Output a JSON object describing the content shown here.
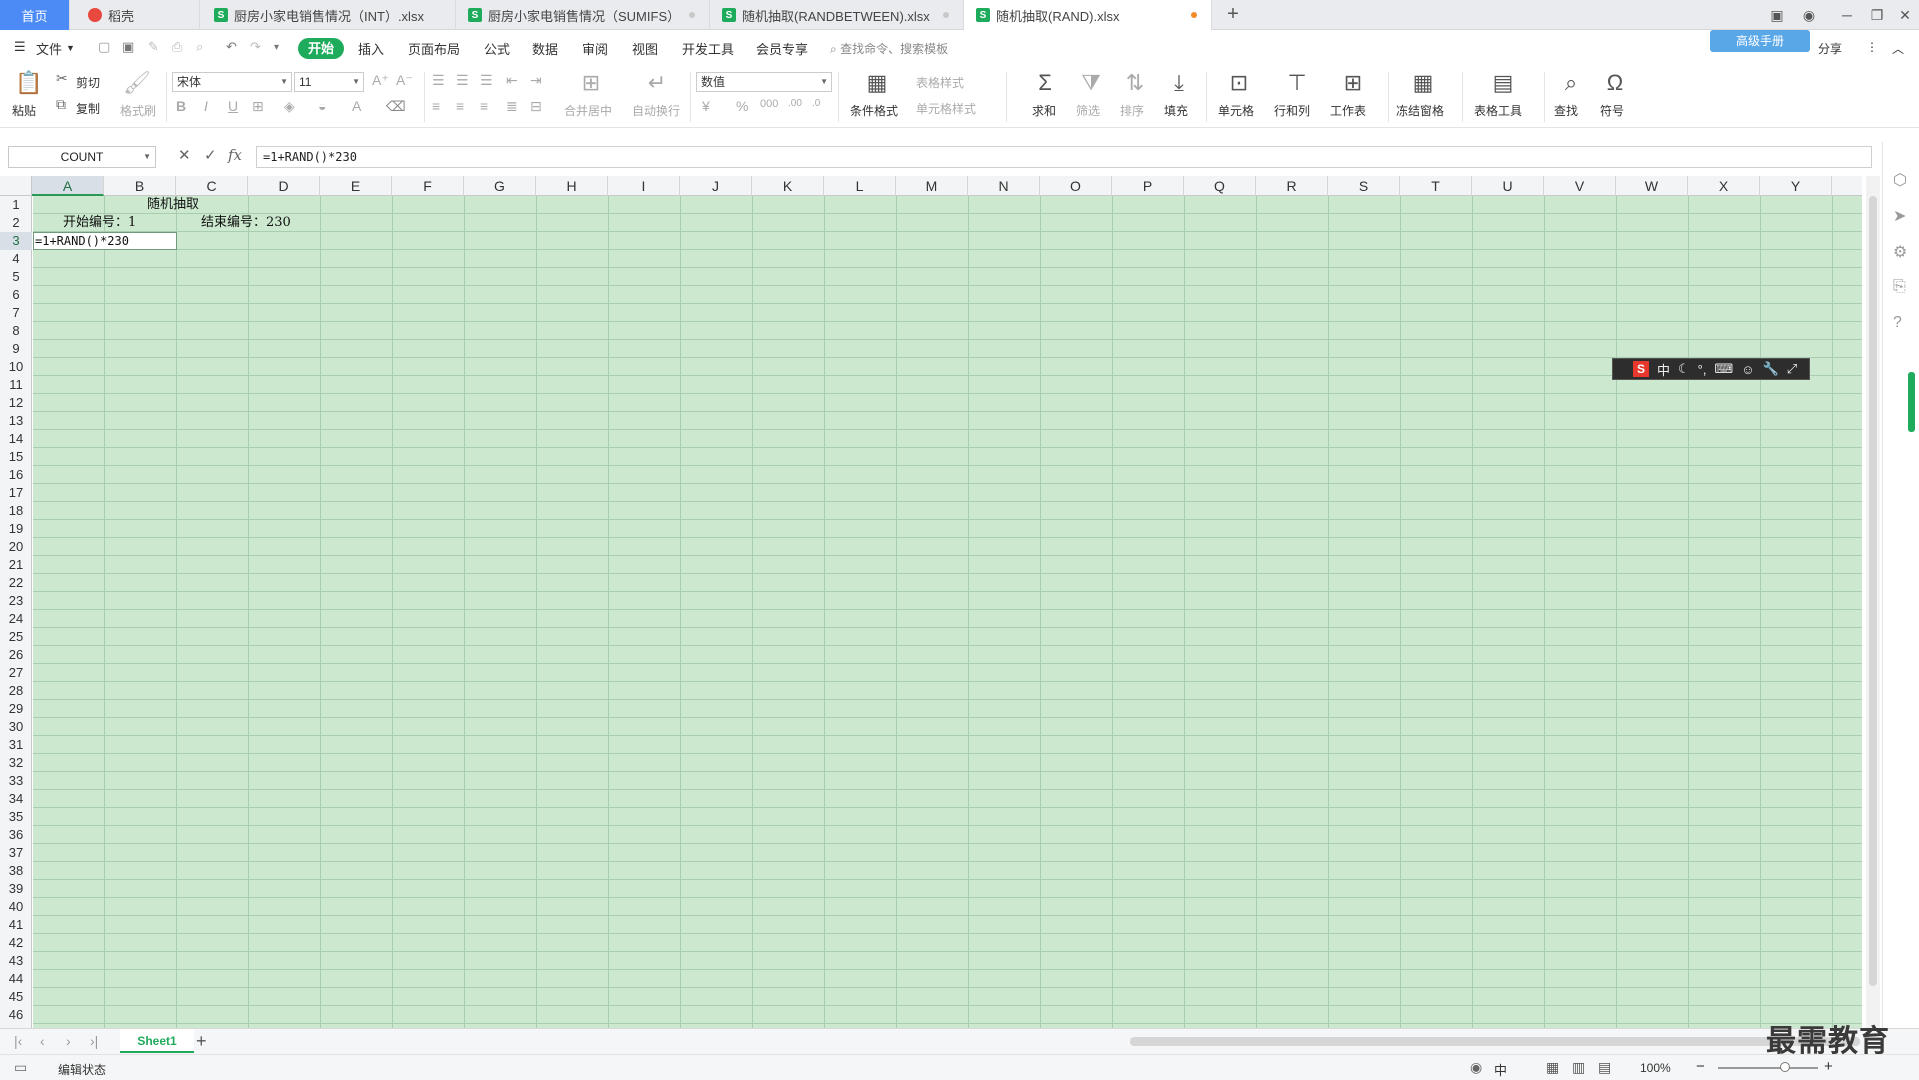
{
  "tabs": {
    "home": "首页",
    "daoke": "稻壳",
    "files": [
      {
        "name": "厨房小家电销售情况（INT）.xlsx"
      },
      {
        "name": "厨房小家电销售情况（SUMIFS）"
      },
      {
        "name": "随机抽取(RANDBETWEEN).xlsx"
      },
      {
        "name": "随机抽取(RAND).xlsx"
      }
    ],
    "file_icon": "S",
    "add": "+"
  },
  "menu": {
    "file": "文件",
    "start": "开始",
    "items": [
      "插入",
      "页面布局",
      "公式",
      "数据",
      "审阅",
      "视图",
      "开发工具",
      "会员专享"
    ],
    "search": "查找命令、搜索模板",
    "right": {
      "share": "分享",
      "badge": "高级手册"
    }
  },
  "ribbon": {
    "paste": "粘贴",
    "cut": "剪切",
    "copy": "复制",
    "format_painter": "格式刷",
    "font_name": "宋体",
    "font_size": "11",
    "merge_center": "合并居中",
    "wrap": "自动换行",
    "number_format": "数值",
    "cond_format": "条件格式",
    "table_style": "表格样式",
    "cell_style": "单元格样式",
    "sum": "求和",
    "filter": "筛选",
    "sort": "排序",
    "fill": "填充",
    "cell": "单元格",
    "rowcol": "行和列",
    "worksheet": "工作表",
    "freeze": "冻结窗格",
    "tabletools": "表格工具",
    "find": "查找",
    "symbol": "符号"
  },
  "formula_bar": {
    "name_box": "COUNT",
    "fx": "fx",
    "formula": "=1+RAND()*230"
  },
  "grid": {
    "columns": [
      "A",
      "B",
      "C",
      "D",
      "E",
      "F",
      "G",
      "H",
      "I",
      "J",
      "K",
      "L",
      "M",
      "N",
      "O",
      "P",
      "Q",
      "R",
      "S",
      "T",
      "U",
      "V",
      "W",
      "X",
      "Y"
    ],
    "selected_column": "A",
    "selected_row": "3",
    "rows_visible": 46,
    "cells": {
      "title": "随机抽取",
      "start_label": "开始编号：1",
      "end_label": "结束编号：230",
      "a3_edit": "=1+RAND()*230"
    }
  },
  "ime": {
    "lang": "中"
  },
  "sheets": {
    "active": "Sheet1",
    "add": "+"
  },
  "status": {
    "mode": "编辑状态",
    "zoom": "100%",
    "ime_indicator": "中"
  },
  "watermark": "最需教育"
}
